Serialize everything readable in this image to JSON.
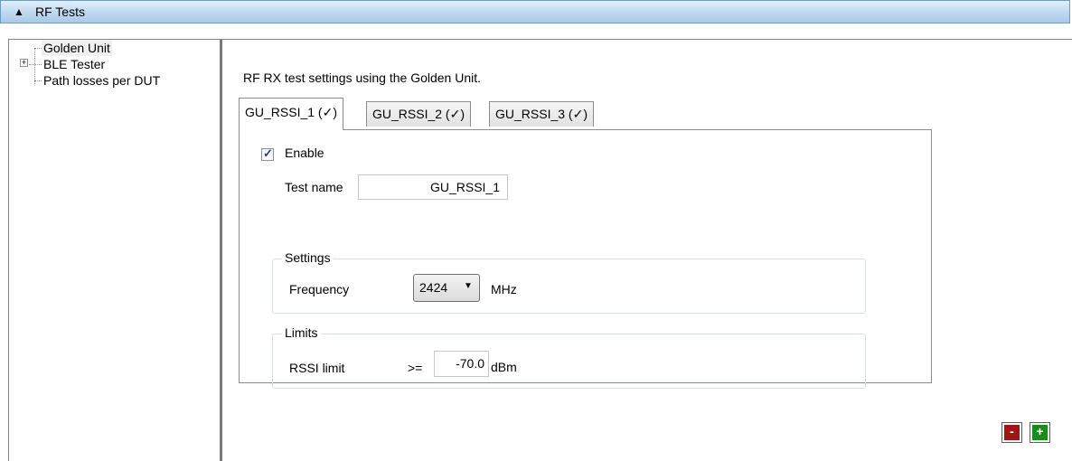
{
  "header": {
    "title": "RF Tests",
    "collapse_icon": "triangle-up"
  },
  "tree": {
    "items": [
      {
        "label": "Golden Unit",
        "selected": true,
        "expandable": false
      },
      {
        "label": "BLE Tester",
        "selected": false,
        "expandable": true,
        "expander": "+"
      },
      {
        "label": "Path losses per DUT",
        "selected": false,
        "expandable": false
      }
    ]
  },
  "main": {
    "description": "RF RX test settings using the Golden Unit.",
    "tabs": [
      {
        "label": "GU_RSSI_1 (✓)",
        "active": true
      },
      {
        "label": "GU_RSSI_2 (✓)",
        "active": false
      },
      {
        "label": "GU_RSSI_3 (✓)",
        "active": false
      }
    ],
    "enable": {
      "label": "Enable",
      "checked": true
    },
    "test_name": {
      "label": "Test name",
      "value": "GU_RSSI_1"
    },
    "settings": {
      "title": "Settings",
      "frequency_label": "Frequency",
      "frequency_value": "2424",
      "frequency_unit": "MHz"
    },
    "limits": {
      "title": "Limits",
      "rssi_label": "RSSI limit",
      "operator": ">=",
      "rssi_value": "-70.0",
      "rssi_unit": "dBm"
    }
  },
  "buttons": {
    "remove_label": "-",
    "add_label": "+"
  },
  "colors": {
    "remove_button": "#a01515",
    "add_button": "#198c19",
    "header_gradient": "#c3dbf2"
  }
}
